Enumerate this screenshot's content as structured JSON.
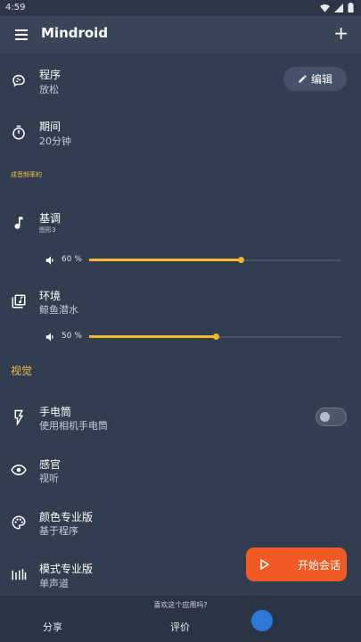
{
  "status_bar": {
    "time": "4:59"
  },
  "app_bar": {
    "title": "Mindroid",
    "menu_icon": "hamburger-menu-icon",
    "add_icon": "plus-icon"
  },
  "program": {
    "label": "程序",
    "value": "放松",
    "icon": "brain-icon"
  },
  "edit_button": {
    "label": "编辑",
    "icon": "pencil-icon"
  },
  "duration": {
    "label": "期间",
    "value": "20分钟",
    "icon": "timer-icon"
  },
  "section_audio": {
    "title": "成音频率的"
  },
  "tone": {
    "label": "基调",
    "value": "图形3",
    "icon": "music-note-icon",
    "volume_label": "60 %",
    "volume": 0.6
  },
  "ambient": {
    "label": "环境",
    "value": "鲸鱼潜水",
    "icon": "library-music-icon",
    "volume_label": "50 %",
    "volume": 0.5
  },
  "section_visual": {
    "title": "视觉"
  },
  "flashlight": {
    "label": "手电筒",
    "value": "使用相机手电筒",
    "icon": "flash-icon",
    "enabled": false
  },
  "senses": {
    "label": "感官",
    "value": "视听",
    "icon": "eye-icon"
  },
  "color_pro": {
    "label": "颜色专业版",
    "value": "基于程序",
    "icon": "palette-icon"
  },
  "pattern_pro": {
    "label": "模式专业版",
    "value": "单声道",
    "icon": "equalizer-icon"
  },
  "fab": {
    "label": "开始会话",
    "icon": "play-icon",
    "color": "#f15a22"
  },
  "bottom_bar": {
    "question": "喜欢这个应用吗?",
    "share": "分享",
    "rate": "评价"
  },
  "colors": {
    "accent": "#f2b92f",
    "background": "#323d4f",
    "section_title": "#f2c24c"
  }
}
